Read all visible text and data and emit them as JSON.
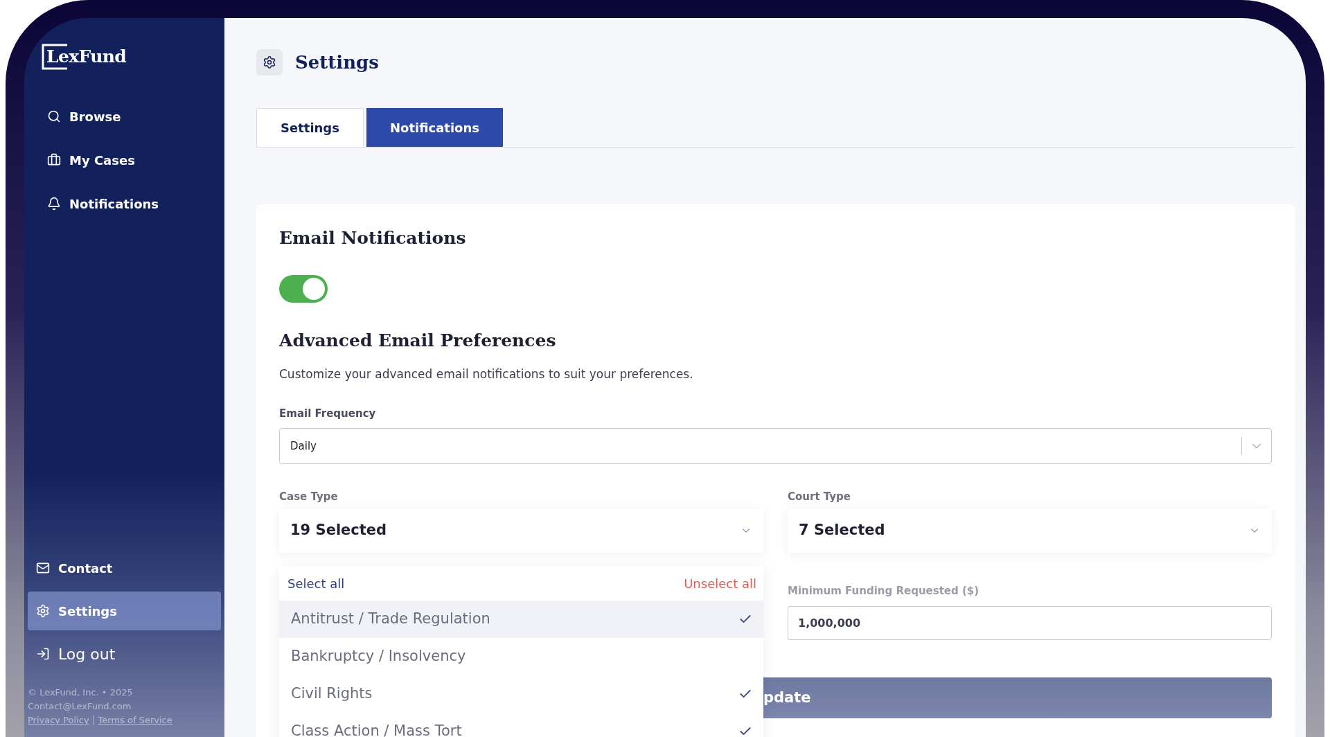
{
  "sidebar": {
    "logo": "LexFund",
    "nav_items": [
      {
        "label": "Browse",
        "kind": "search",
        "selected": false
      },
      {
        "label": "My Cases",
        "kind": "briefcase",
        "selected": false
      },
      {
        "label": "Notifications",
        "kind": "bell",
        "selected": false
      }
    ],
    "bottom_items": [
      {
        "label": "Contact",
        "kind": "mail",
        "selected": false
      },
      {
        "label": "Settings",
        "kind": "gear",
        "selected": true
      },
      {
        "label": "Log out",
        "kind": "logout",
        "selected": false
      }
    ],
    "footer": {
      "copyright": "© LexFund, Inc. • 2025",
      "email": "Contact@LexFund.com",
      "links": [
        "Privacy Policy",
        "Terms of Service"
      ]
    }
  },
  "page": {
    "title": "Settings"
  },
  "tabs": [
    {
      "label": "Settings",
      "selected": false
    },
    {
      "label": "Notifications",
      "selected": true
    }
  ],
  "email_notifications": {
    "title": "Email Notifications",
    "on": true
  },
  "advanced": {
    "title": "Advanced Email Preferences",
    "description": "Customize your advanced email notifications to suit your preferences.",
    "email_frequency": {
      "label": "Email Frequency",
      "value": "Daily"
    },
    "case_type": {
      "label": "Case Type",
      "value": "19 Selected",
      "expanded": true,
      "select_all": "Select all",
      "unselect_all": "Unselect all",
      "options": [
        {
          "label": "Antitrust / Trade Regulation",
          "checked": true,
          "highlighted": true
        },
        {
          "label": "Bankruptcy / Insolvency",
          "checked": false,
          "highlighted": false
        },
        {
          "label": "Civil Rights",
          "checked": true,
          "highlighted": false
        },
        {
          "label": "Class Action / Mass Tort",
          "checked": true,
          "highlighted": false
        }
      ]
    },
    "court_type": {
      "label": "Court Type",
      "value": "7 Selected"
    },
    "minimum_funding": {
      "label": "Minimum Funding Requested ($)",
      "value": "1,000,000"
    },
    "update_button": "pdate"
  }
}
